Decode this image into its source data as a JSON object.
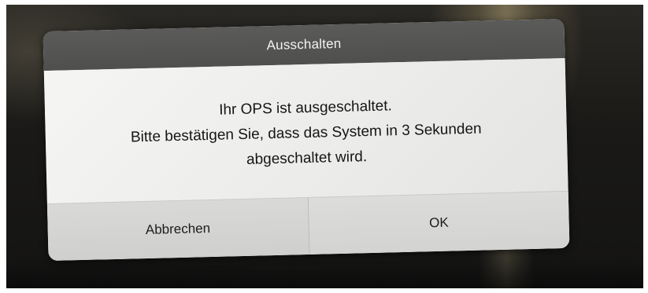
{
  "dialog": {
    "title": "Ausschalten",
    "message_lines": [
      "Ihr OPS ist ausgeschaltet.",
      "Bitte bestätigen Sie, dass das System in 3 Sekunden",
      "abgeschaltet wird."
    ],
    "cancel_label": "Abbrechen",
    "ok_label": "OK"
  }
}
